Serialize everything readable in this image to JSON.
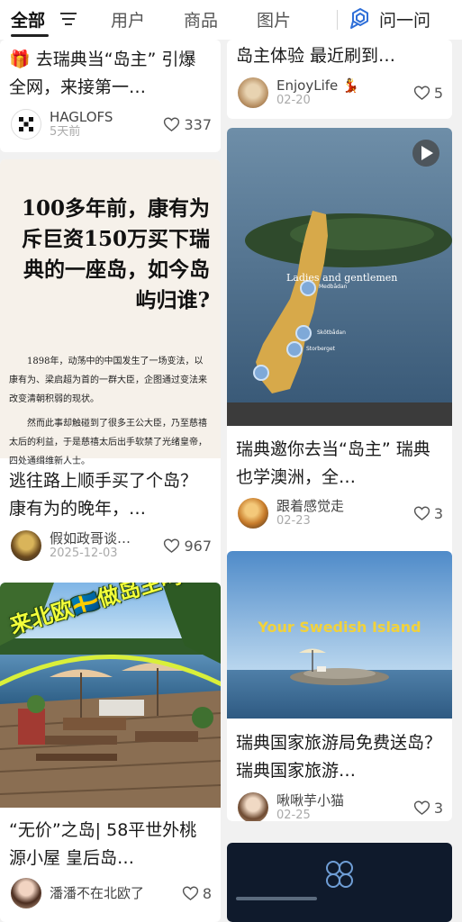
{
  "tabs": [
    {
      "label": "全部",
      "active": true
    },
    {
      "label": "用户",
      "active": false
    },
    {
      "label": "商品",
      "active": false
    },
    {
      "label": "图片",
      "active": false
    }
  ],
  "ask_label": "问一问",
  "left": [
    {
      "title": "🎁 去瑞典当“岛主” 引爆全网，来接第一…",
      "author": "HAGLOFS",
      "date": "5天前",
      "likes": "337"
    },
    {
      "poster_headline": "100多年前，康有为斥巨资150万买下瑞典的一座岛，如今岛屿归谁?",
      "poster_p1": "1898年，动荡中的中国发生了一场变法，以康有为、梁启超为首的一群大臣，企图通过变法来改变清朝积弱的现状。",
      "poster_p2": "然而此事却触碰到了很多王公大臣，乃至慈禧太后的利益，于是慈禧太后出手软禁了光绪皇帝，四处通缉维新人士。",
      "title": "逃往路上顺手买了个岛？康有为的晚年，…",
      "author": "假如政哥谈…",
      "date": "2025-12-03",
      "likes": "967"
    },
    {
      "overlay": "来北欧🇸🇪做岛主吗？",
      "title": "“无价”之岛| 58平世外桃源小屋 皇后岛…",
      "author": "潘潘不在北欧了",
      "likes": "8"
    }
  ],
  "right": [
    {
      "title": "岛主体验 最近刷到…",
      "author": "EnjoyLife 💃",
      "date": "02-20",
      "likes": "5"
    },
    {
      "video_caption": "Ladies and gentlemen",
      "map_labels": [
        "Medbådan",
        "Skötbådan",
        "Storberget"
      ],
      "title": "瑞典邀你去当“岛主” 瑞典也学澳洲，全…",
      "author": "跟着感觉走",
      "date": "02-23",
      "likes": "3"
    },
    {
      "image_caption": "Your Swedish Island",
      "title": "瑞典国家旅游局免费送岛？ 瑞典国家旅游…",
      "author": "啾啾芋小猫",
      "date": "02-25",
      "likes": "3"
    }
  ],
  "colors": {
    "accent": "#2f6fd8",
    "heart": "#555555"
  }
}
